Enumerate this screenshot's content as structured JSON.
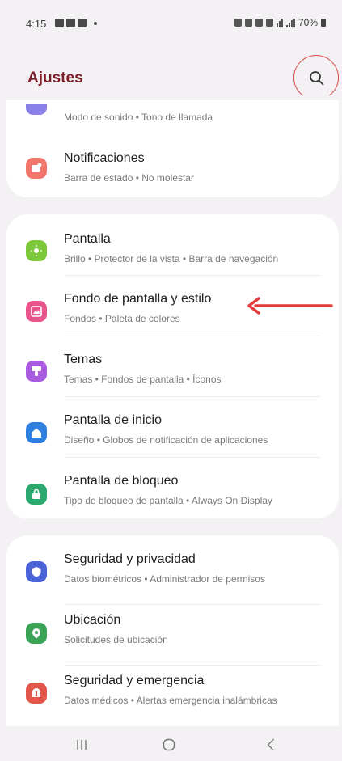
{
  "status_bar": {
    "time": "4:15",
    "battery": "70%"
  },
  "header": {
    "title": "Ajustes"
  },
  "sections": [
    {
      "items": [
        {
          "title": "",
          "subtitle": "Modo de sonido  •  Tono de llamada",
          "icon": "sound-icon",
          "color": "#8b7fe8"
        },
        {
          "title": "Notificaciones",
          "subtitle": "Barra de estado  •  No molestar",
          "icon": "notifications-icon",
          "color": "#f2766b"
        }
      ]
    },
    {
      "items": [
        {
          "title": "Pantalla",
          "subtitle": "Brillo  •  Protector de la vista  •  Barra de navegación",
          "icon": "display-icon",
          "color": "#7cc83a"
        },
        {
          "title": "Fondo de pantalla y estilo",
          "subtitle": "Fondos  •  Paleta de colores",
          "icon": "wallpaper-icon",
          "color": "#e8558d"
        },
        {
          "title": "Temas",
          "subtitle": "Temas  •  Fondos de pantalla  •  Íconos",
          "icon": "themes-icon",
          "color": "#a95ce0"
        },
        {
          "title": "Pantalla de inicio",
          "subtitle": "Diseño  •  Globos de notificación de aplicaciones",
          "icon": "home-screen-icon",
          "color": "#2f7fe0"
        },
        {
          "title": "Pantalla de bloqueo",
          "subtitle": "Tipo de bloqueo de pantalla  •  Always On Display",
          "icon": "lock-screen-icon",
          "color": "#2aa86d"
        }
      ]
    },
    {
      "items": [
        {
          "title": "Seguridad y privacidad",
          "subtitle": "Datos biométricos  •  Administrador de permisos",
          "icon": "security-icon",
          "color": "#4a63d6"
        },
        {
          "title": "Ubicación",
          "subtitle": "Solicitudes de ubicación",
          "icon": "location-icon",
          "color": "#3aa356"
        },
        {
          "title": "Seguridad y emergencia",
          "subtitle": "Datos médicos  •  Alertas emergencia inalámbricas",
          "icon": "emergency-icon",
          "color": "#e2574c"
        }
      ]
    }
  ],
  "colors": {
    "accent_title": "#7a1d29",
    "annotation": "#e23c3c",
    "background": "#f3f1f3"
  }
}
